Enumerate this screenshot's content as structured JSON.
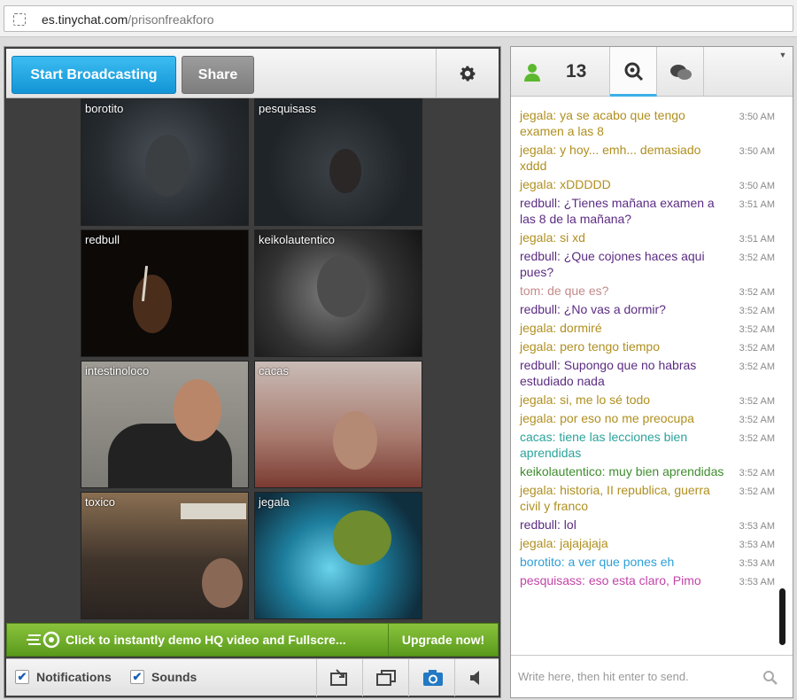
{
  "browser": {
    "url_host": "es.tinychat.com",
    "url_path": "/prisonfreakforo"
  },
  "toolbar": {
    "broadcast_label": "Start Broadcasting",
    "share_label": "Share",
    "settings_icon": "gear-icon"
  },
  "videos": [
    {
      "name": "borotito",
      "bg": "#2a3036"
    },
    {
      "name": "pesquisass",
      "bg": "#23282d"
    },
    {
      "name": "redbull",
      "bg": "#0e0b09"
    },
    {
      "name": "keikolautentico",
      "bg": "#3a3a3a"
    },
    {
      "name": "intestinoloco",
      "bg": "#8d8a83"
    },
    {
      "name": "cacas",
      "bg": "#b79b90"
    },
    {
      "name": "toxico",
      "bg": "#4b3d33"
    },
    {
      "name": "jegala",
      "bg": "#1c5a72"
    }
  ],
  "promo": {
    "text": "Click to instantly demo HQ video and Fullscre...",
    "upgrade_label": "Upgrade now!"
  },
  "options": {
    "notifications_label": "Notifications",
    "sounds_label": "Sounds",
    "notifications_checked": true,
    "sounds_checked": true
  },
  "userlist": {
    "count": "13"
  },
  "chat": {
    "placeholder": "Write here, then hit enter to send.",
    "messages": [
      {
        "text": "jegala: ya se acabo que tengo examen a  las 8",
        "time": "3:50 AM",
        "color": "#b08f1f"
      },
      {
        "text": "jegala: y hoy... emh... demasiado xddd",
        "time": "3:50 AM",
        "color": "#b08f1f"
      },
      {
        "text": "jegala: xDDDDD",
        "time": "3:50 AM",
        "color": "#b08f1f"
      },
      {
        "text": "redbull: ¿Tienes mañana examen a las 8 de la mañana?",
        "time": "3:51 AM",
        "color": "#5b2c83"
      },
      {
        "text": "jegala: si xd",
        "time": "3:51 AM",
        "color": "#b08f1f"
      },
      {
        "text": "redbull: ¿Que cojones haces aqui pues?",
        "time": "3:52 AM",
        "color": "#5b2c83"
      },
      {
        "text": "tom: de que es?",
        "time": "3:52 AM",
        "color": "#c58a8a"
      },
      {
        "text": "redbull: ¿No vas a dormir?",
        "time": "3:52 AM",
        "color": "#5b2c83"
      },
      {
        "text": "jegala: dormiré",
        "time": "3:52 AM",
        "color": "#b08f1f"
      },
      {
        "text": "jegala: pero tengo tiempo",
        "time": "3:52 AM",
        "color": "#b08f1f"
      },
      {
        "text": "redbull: Supongo que no habras estudiado nada",
        "time": "3:52 AM",
        "color": "#5b2c83"
      },
      {
        "text": "jegala: si, me lo sé todo",
        "time": "3:52 AM",
        "color": "#b08f1f"
      },
      {
        "text": "jegala: por eso no me preocupa",
        "time": "3:52 AM",
        "color": "#b08f1f"
      },
      {
        "text": "cacas: tiene las lecciones bien aprendidas",
        "time": "3:52 AM",
        "color": "#2aa39b"
      },
      {
        "text": "keikolautentico: muy bien aprendidas",
        "time": "3:52 AM",
        "color": "#3f8d2f"
      },
      {
        "text": "jegala: historia, II republica, guerra civil y franco",
        "time": "3:52 AM",
        "color": "#b08f1f"
      },
      {
        "text": "redbull: lol",
        "time": "3:53 AM",
        "color": "#5b2c83"
      },
      {
        "text": "jegala: jajajajaja",
        "time": "3:53 AM",
        "color": "#b08f1f"
      },
      {
        "text": "borotito: a ver que  pones eh",
        "time": "3:53 AM",
        "color": "#2c9fd6"
      },
      {
        "text": "pesquisass: eso esta claro, Pimo",
        "time": "3:53 AM",
        "color": "#c244a8"
      }
    ]
  }
}
